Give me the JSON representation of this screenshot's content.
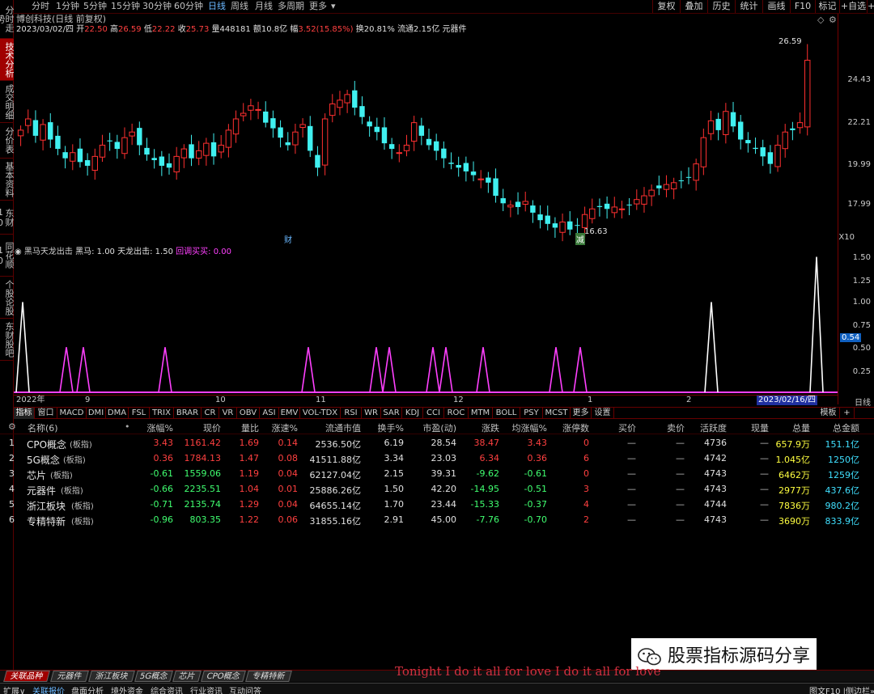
{
  "leftbar": {
    "items": [
      "分时走势",
      "技术分析",
      "成交明细",
      "分价表",
      "基本资料",
      "东财10",
      "同花顺10",
      "个股论股",
      "东财股吧"
    ],
    "active_index": 1
  },
  "topbar": {
    "periods": [
      "分时",
      "1分钟",
      "5分钟",
      "15分钟",
      "30分钟",
      "60分钟",
      "日线",
      "周线",
      "月线",
      "多周期",
      "更多"
    ],
    "selected": "日线",
    "buttons": [
      "复权",
      "叠加",
      "历史",
      "统计",
      "画线",
      "F10",
      "标记",
      "+自选",
      "+"
    ]
  },
  "header": {
    "title": "博创科技(日线 前复权)",
    "date": "2023/03/02/四",
    "open_label": "开",
    "open": "22.50",
    "high_label": "高",
    "high": "26.59",
    "low_label": "低",
    "low": "22.22",
    "close_label": "收",
    "close": "25.73",
    "vol_label": "量",
    "vol": "448181",
    "amt_label": "额",
    "amt": "10.8亿",
    "chg_label": "幅",
    "chg": "3.52(15.85%)",
    "turnover": "换20.81%",
    "float": "流通2.15亿",
    "sector": "元器件"
  },
  "kline_axis": {
    "labels": [
      "24.43",
      "22.21",
      "19.99",
      "17.99"
    ],
    "corner": "X10"
  },
  "kline_notes": {
    "high_marker": "26.59",
    "low_marker": "16.63",
    "cai": "财",
    "jian": "减"
  },
  "indicator": {
    "name": "黑马天龙出击",
    "heima": "黑马: 1.00",
    "tianlong": "天龙出击: 1.50",
    "buy": "回调买买: 0.00",
    "axis": [
      "1.50",
      "1.25",
      "1.00",
      "0.75",
      "0.54",
      "0.50",
      "0.25"
    ]
  },
  "xaxis": {
    "labels": [
      "2022年",
      "9",
      "10",
      "11",
      "12",
      "1",
      "2"
    ],
    "current": "2023/02/16/四",
    "period": "日线"
  },
  "tabs": {
    "items": [
      "指标",
      "窗口",
      "MACD",
      "DMI",
      "DMA",
      "FSL",
      "TRIX",
      "BRAR",
      "CR",
      "VR",
      "OBV",
      "ASI",
      "EMV",
      "VOL-TDX",
      "RSI",
      "WR",
      "SAR",
      "KDJ",
      "CCI",
      "ROC",
      "MTM",
      "BOLL",
      "PSY",
      "MCST",
      "更多",
      "设置"
    ],
    "right": [
      "模板",
      "+"
    ]
  },
  "table": {
    "headers": [
      "名称(6)",
      "涨幅%",
      "现价",
      "量比",
      "涨速%",
      "流通市值",
      "换手%",
      "市盈(动)",
      "涨跌",
      "均涨幅%",
      "涨停数",
      "买价",
      "卖价",
      "活跃度",
      "现量",
      "总量",
      "总金额"
    ],
    "rows": [
      {
        "idx": "1",
        "name": "CPO概念",
        "tag": "(板指)",
        "chg": "3.43",
        "price": "1161.42",
        "lb": "1.69",
        "speed": "0.14",
        "mcap": "2536.50亿",
        "turn": "6.19",
        "pe": "28.54",
        "delta": "38.47",
        "avg": "3.43",
        "zt": "0",
        "bid": "—",
        "ask": "—",
        "act": "4736",
        "cur": "—",
        "vol": "657.9万",
        "amt": "151.1亿",
        "dir": "up"
      },
      {
        "idx": "2",
        "name": "5G概念",
        "tag": "(板指)",
        "chg": "0.36",
        "price": "1784.13",
        "lb": "1.47",
        "speed": "0.08",
        "mcap": "41511.88亿",
        "turn": "3.34",
        "pe": "23.03",
        "delta": "6.34",
        "avg": "0.36",
        "zt": "6",
        "bid": "—",
        "ask": "—",
        "act": "4742",
        "cur": "—",
        "vol": "1.045亿",
        "amt": "1250亿",
        "dir": "up"
      },
      {
        "idx": "3",
        "name": "芯片",
        "tag": "(板指)",
        "chg": "-0.61",
        "price": "1559.06",
        "lb": "1.19",
        "speed": "0.04",
        "mcap": "62127.04亿",
        "turn": "2.15",
        "pe": "39.31",
        "delta": "-9.62",
        "avg": "-0.61",
        "zt": "0",
        "bid": "—",
        "ask": "—",
        "act": "4743",
        "cur": "—",
        "vol": "6462万",
        "amt": "1259亿",
        "dir": "down"
      },
      {
        "idx": "4",
        "name": "元器件",
        "tag": "(板指)",
        "chg": "-0.66",
        "price": "2235.51",
        "lb": "1.04",
        "speed": "0.01",
        "mcap": "25886.26亿",
        "turn": "1.50",
        "pe": "42.20",
        "delta": "-14.95",
        "avg": "-0.51",
        "zt": "3",
        "bid": "—",
        "ask": "—",
        "act": "4743",
        "cur": "—",
        "vol": "2977万",
        "amt": "437.6亿",
        "dir": "down"
      },
      {
        "idx": "5",
        "name": "浙江板块",
        "tag": "(板指)",
        "chg": "-0.71",
        "price": "2135.74",
        "lb": "1.29",
        "speed": "0.04",
        "mcap": "64655.14亿",
        "turn": "1.70",
        "pe": "23.44",
        "delta": "-15.33",
        "avg": "-0.37",
        "zt": "4",
        "bid": "—",
        "ask": "—",
        "act": "4744",
        "cur": "—",
        "vol": "7836万",
        "amt": "980.2亿",
        "dir": "down"
      },
      {
        "idx": "6",
        "name": "专精特新",
        "tag": "(板指)",
        "chg": "-0.96",
        "price": "803.35",
        "lb": "1.22",
        "speed": "0.06",
        "mcap": "31855.16亿",
        "turn": "2.91",
        "pe": "45.00",
        "delta": "-7.76",
        "avg": "-0.70",
        "zt": "2",
        "bid": "—",
        "ask": "—",
        "act": "4743",
        "cur": "—",
        "vol": "3690万",
        "amt": "833.9亿",
        "dir": "down"
      }
    ]
  },
  "watermark": {
    "text": "股票指标源码分享"
  },
  "bottom_tabs": [
    "关联品种",
    "元器件",
    "浙江板块",
    "5G概念",
    "芯片",
    "CPO概念",
    "专精特新"
  ],
  "lyric": "Tonight I do it all for love I do it all for love",
  "statusbar": {
    "items": [
      "扩展∨",
      "关联报价",
      "盘面分析",
      "境外资金",
      "综合资讯",
      "行业资讯",
      "互动问答"
    ],
    "right": "图文F10 |侧边栏»"
  },
  "colors": {
    "up": "#ff4040",
    "down": "#40ff70",
    "candle_up": "#ff3030",
    "candle_down": "#40f0f0",
    "indicator_magenta": "#ff40ff"
  }
}
